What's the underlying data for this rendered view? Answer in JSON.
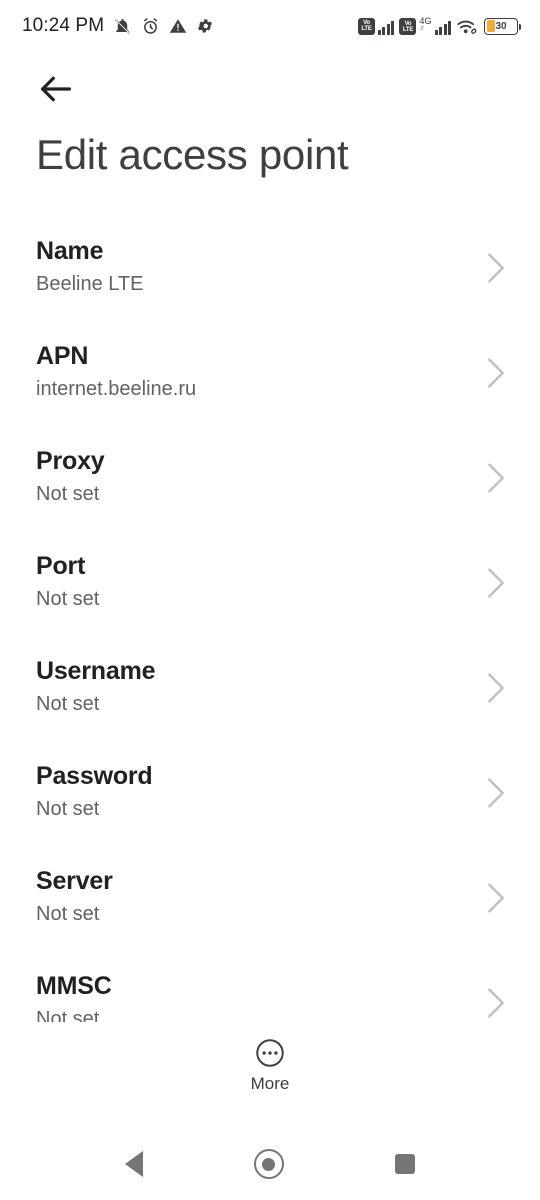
{
  "statusbar": {
    "time": "10:24 PM",
    "left_icons": [
      "bell-muted-icon",
      "alarm-icon",
      "warning-icon",
      "gear-icon"
    ],
    "sim1": {
      "volte_top": "Vo",
      "volte_bottom": "LTE",
      "signal_bars": 4
    },
    "sim2": {
      "volte_top": "Vo",
      "volte_bottom": "LTE",
      "network": "4G",
      "signal_bars": 4
    },
    "wifi": "wifi-icon",
    "battery": {
      "percent": "30",
      "color": "#F4A93C"
    }
  },
  "appbar": {
    "back_icon": "back-arrow-icon",
    "title": "Edit access point"
  },
  "list": {
    "chevron_icon": "chevron-right-icon",
    "rows": [
      {
        "title": "Name",
        "value": "Beeline LTE"
      },
      {
        "title": "APN",
        "value": "internet.beeline.ru"
      },
      {
        "title": "Proxy",
        "value": "Not set"
      },
      {
        "title": "Port",
        "value": "Not set"
      },
      {
        "title": "Username",
        "value": "Not set"
      },
      {
        "title": "Password",
        "value": "Not set"
      },
      {
        "title": "Server",
        "value": "Not set"
      },
      {
        "title": "MMSC",
        "value": "Not set"
      }
    ]
  },
  "more": {
    "icon": "overflow-circle-icon",
    "label": "More"
  },
  "navbar": {
    "back": "nav-back-icon",
    "home": "nav-home-icon",
    "recents": "nav-recents-icon"
  }
}
